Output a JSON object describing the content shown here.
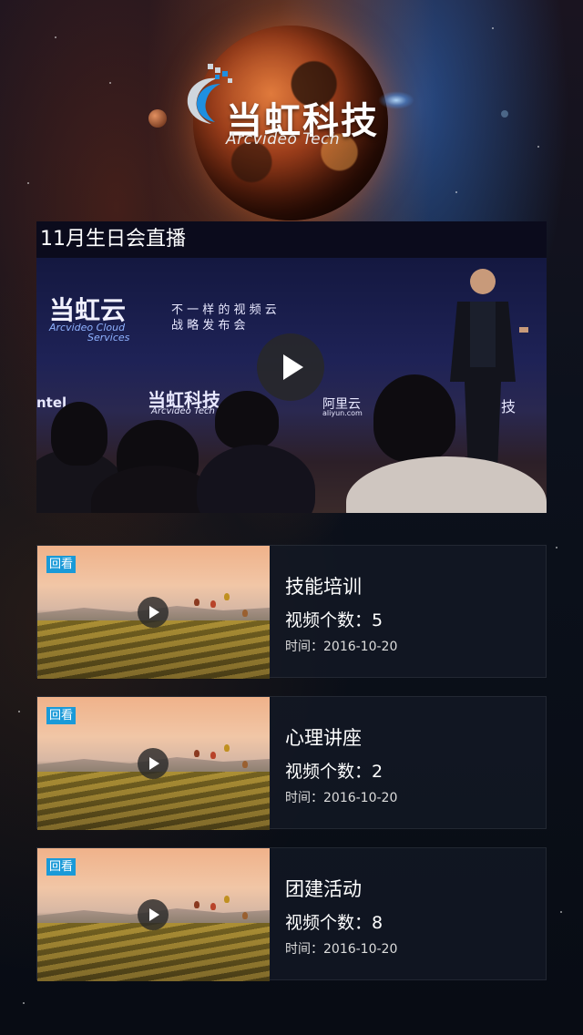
{
  "header": {
    "logo_cn": "当虹科技",
    "logo_en": "Arcvideo Tech"
  },
  "live": {
    "title": "11月生日会直播",
    "stage": {
      "brand_cn": "当虹云",
      "brand_en_1": "Arcvideo Cloud",
      "brand_en_2": "Services",
      "slogan_1": "不 一 样 的 视 频 云",
      "slogan_2": "战 略 发 布 会",
      "sponsor_1": "ntel",
      "sponsor_2_cn": "当虹科技",
      "sponsor_2_en": "Arcvideo Tech",
      "sponsor_3_cn": "阿里云",
      "sponsor_3_en": "aliyun.com",
      "sponsor_4": "技"
    }
  },
  "videos": [
    {
      "badge": "回看",
      "title": "技能培训",
      "count": "视频个数：5",
      "time": "时间：2016-10-20"
    },
    {
      "badge": "回看",
      "title": "心理讲座",
      "count": "视频个数：2",
      "time": "时间：2016-10-20"
    },
    {
      "badge": "回看",
      "title": "团建活动",
      "count": "视频个数：8",
      "time": "时间：2016-10-20"
    }
  ],
  "colors": {
    "badge": "#1a9ad8",
    "logo_blue": "#1e8fe0"
  }
}
